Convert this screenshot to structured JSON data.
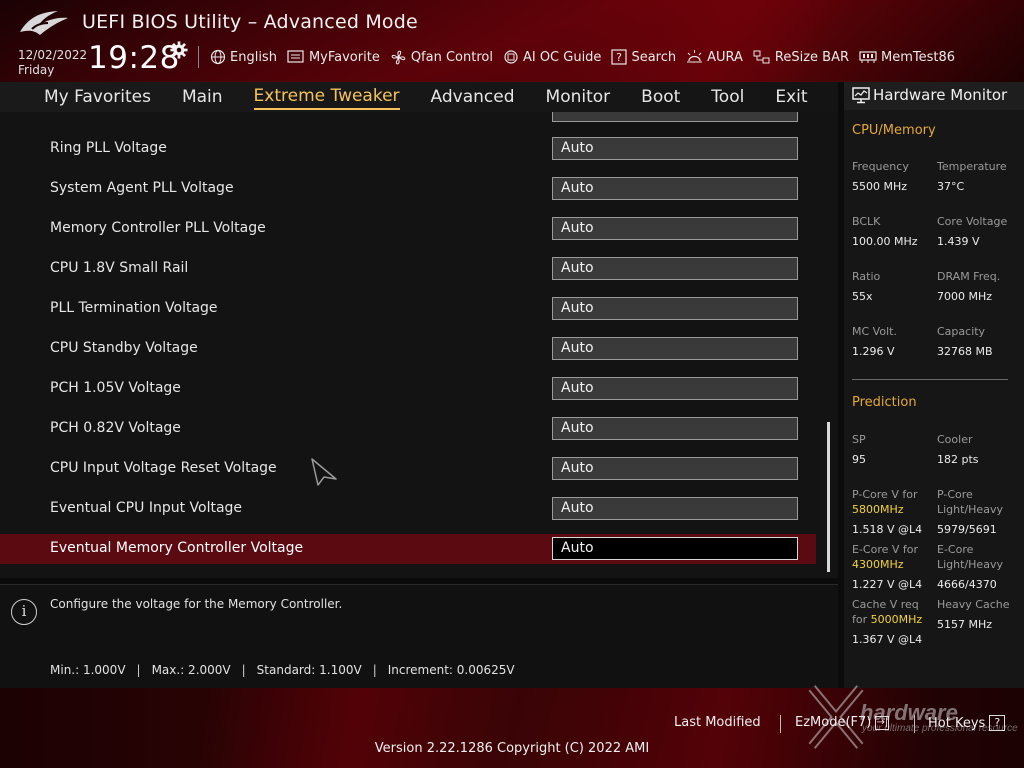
{
  "header": {
    "title": "UEFI BIOS Utility – Advanced Mode",
    "date": "12/02/2022",
    "day": "Friday",
    "time": "19:28",
    "toolbar": [
      {
        "label": "English",
        "icon": "globe-icon"
      },
      {
        "label": "MyFavorite",
        "icon": "favorite-list-icon"
      },
      {
        "label": "Qfan Control",
        "icon": "fan-icon"
      },
      {
        "label": "AI OC Guide",
        "icon": "ai-chip-icon"
      },
      {
        "label": "Search",
        "icon": "search-help-icon"
      },
      {
        "label": "AURA",
        "icon": "aura-light-icon"
      },
      {
        "label": "ReSize BAR",
        "icon": "resize-bar-icon"
      },
      {
        "label": "MemTest86",
        "icon": "memory-icon"
      }
    ]
  },
  "nav": {
    "tabs": [
      "My Favorites",
      "Main",
      "Extreme Tweaker",
      "Advanced",
      "Monitor",
      "Boot",
      "Tool",
      "Exit"
    ],
    "active": "Extreme Tweaker"
  },
  "settings": [
    {
      "label": "Ring PLL Voltage",
      "value": "Auto"
    },
    {
      "label": "System Agent PLL Voltage",
      "value": "Auto"
    },
    {
      "label": "Memory Controller PLL Voltage",
      "value": "Auto"
    },
    {
      "label": "CPU 1.8V Small Rail",
      "value": "Auto"
    },
    {
      "label": "PLL Termination Voltage",
      "value": "Auto"
    },
    {
      "label": "CPU Standby Voltage",
      "value": "Auto"
    },
    {
      "label": "PCH 1.05V Voltage",
      "value": "Auto"
    },
    {
      "label": "PCH 0.82V Voltage",
      "value": "Auto"
    },
    {
      "label": "CPU Input Voltage Reset Voltage",
      "value": "Auto"
    },
    {
      "label": "Eventual CPU Input Voltage",
      "value": "Auto"
    },
    {
      "label": "Eventual Memory Controller Voltage",
      "value": "Auto"
    }
  ],
  "selected_index": 10,
  "info": {
    "description": "Configure the voltage for the Memory Controller.",
    "min": "Min.: 1.000V",
    "max": "Max.: 2.000V",
    "standard": "Standard: 1.100V",
    "increment": "Increment: 0.00625V"
  },
  "hardware_monitor": {
    "title": "Hardware Monitor",
    "cpu_memory": {
      "heading": "CPU/Memory",
      "items": [
        {
          "label": "Frequency",
          "value": "5500 MHz"
        },
        {
          "label": "Temperature",
          "value": "37°C"
        },
        {
          "label": "BCLK",
          "value": "100.00 MHz"
        },
        {
          "label": "Core Voltage",
          "value": "1.439 V"
        },
        {
          "label": "Ratio",
          "value": "55x"
        },
        {
          "label": "DRAM Freq.",
          "value": "7000 MHz"
        },
        {
          "label": "MC Volt.",
          "value": "1.296 V"
        },
        {
          "label": "Capacity",
          "value": "32768 MB"
        }
      ]
    },
    "prediction": {
      "heading": "Prediction",
      "sp_label": "SP",
      "sp_value": "95",
      "cooler_label": "Cooler",
      "cooler_value": "182 pts",
      "pcore_label_a": "P-Core V for",
      "pcore_freq": "5800MHz",
      "pcore_value": "1.518 V @L4",
      "pcore_lh_label_a": "P-Core",
      "pcore_lh_label_b": "Light/Heavy",
      "pcore_lh_value": "5979/5691",
      "ecore_label_a": "E-Core V for",
      "ecore_freq": "4300MHz",
      "ecore_value": "1.227 V @L4",
      "ecore_lh_label_a": "E-Core",
      "ecore_lh_label_b": "Light/Heavy",
      "ecore_lh_value": "4666/4370",
      "cache_label_a": "Cache V req",
      "cache_label_for": "for",
      "cache_freq": "5000MHz",
      "cache_value": "1.367 V @L4",
      "heavy_cache_label": "Heavy Cache",
      "heavy_cache_value": "5157 MHz"
    }
  },
  "footer": {
    "last_modified": "Last Modified",
    "ezmode": "EzMode(F7)",
    "ezmode_key": "→|",
    "hotkeys": "Hot Keys",
    "hotkeys_key": "?",
    "version": "Version 2.22.1286 Copyright (C) 2022 AMI",
    "watermark": "hardware",
    "watermark_sub": "your ultimate professional resource"
  },
  "colors": {
    "accent": "#f6c35a",
    "selected_row": "#5a0a10",
    "section_heading": "#e2a93a",
    "prediction_freq": "#f2d33a"
  }
}
